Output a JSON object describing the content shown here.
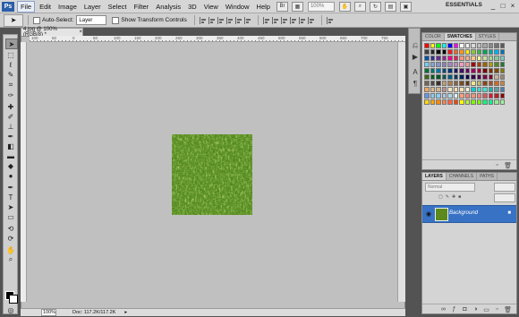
{
  "menubar": {
    "logo": "Ps",
    "items": [
      "File",
      "Edit",
      "Image",
      "Layer",
      "Select",
      "Filter",
      "Analysis",
      "3D",
      "View",
      "Window",
      "Help"
    ],
    "zoom": "100%",
    "workspace": "ESSENTIALS",
    "win_buttons": [
      "_",
      "□",
      "×"
    ]
  },
  "options": {
    "auto_select_label": "Auto-Select:",
    "auto_select_value": "Layer",
    "transform_label": "Show Transform Controls"
  },
  "document": {
    "tab_title": "4.jpg @ 100% (RGB/8) *",
    "ruler_numbers": [
      "100",
      "50",
      "0",
      "50",
      "100",
      "150",
      "200",
      "250",
      "300",
      "350",
      "400",
      "450",
      "500",
      "550",
      "600",
      "650",
      "700",
      "750"
    ],
    "status_zoom": "100%",
    "status_doc": "Doc: 117.2K/117.2K"
  },
  "swatches": {
    "tabs": [
      "COLOR",
      "SWATCHES",
      "STYLES"
    ],
    "colors": [
      "#ff0000",
      "#ffff00",
      "#00ff00",
      "#00ffff",
      "#0000ff",
      "#ff00ff",
      "#ffffff",
      "#f2f2f2",
      "#d9d9d9",
      "#bfbfbf",
      "#a6a6a6",
      "#8c8c8c",
      "#737373",
      "#595959",
      "#404040",
      "#262626",
      "#0d0d0d",
      "#000000",
      "#ed1c24",
      "#f26522",
      "#f7941d",
      "#fff200",
      "#8dc63f",
      "#39b54a",
      "#00a651",
      "#00a99d",
      "#00aeef",
      "#0072bc",
      "#0054a6",
      "#2e3192",
      "#662d91",
      "#92278f",
      "#ec008c",
      "#ed145b",
      "#f69679",
      "#f9ad81",
      "#fdc689",
      "#fff799",
      "#c4df9b",
      "#a3d39c",
      "#82ca9c",
      "#7accc8",
      "#6dcff6",
      "#7da7d9",
      "#8393ca",
      "#8781bd",
      "#a187be",
      "#bd8cbf",
      "#f49ac1",
      "#f5989d",
      "#9e0b0f",
      "#a0410d",
      "#a36209",
      "#aba000",
      "#598527",
      "#1a7b30",
      "#007236",
      "#00746b",
      "#0076a3",
      "#004b80",
      "#003471",
      "#1b1464",
      "#440e62",
      "#630460",
      "#9e005d",
      "#9e0039",
      "#790000",
      "#7b2e00",
      "#7d4900",
      "#827b00",
      "#406618",
      "#005e20",
      "#005826",
      "#005952",
      "#005b7f",
      "#003663",
      "#002157",
      "#0d004c",
      "#32004b",
      "#4b0049",
      "#7b0046",
      "#7a0026",
      "#c7b299",
      "#998675",
      "#736357",
      "#534741",
      "#37302a",
      "#c69c6d",
      "#a67c52",
      "#8c6239",
      "#754c24",
      "#603913",
      "#f0e68c",
      "#bdb76b",
      "#8b4513",
      "#a0522d",
      "#d2691e",
      "#cd853f",
      "#f4a460",
      "#deb887",
      "#d2b48c",
      "#bc8f8f",
      "#ffe4c4",
      "#ffdead",
      "#f5deb3",
      "#fff8dc",
      "#00ced1",
      "#48d1cc",
      "#40e0d0",
      "#20b2aa",
      "#5f9ea0",
      "#4682b4",
      "#6495ed",
      "#87ceeb",
      "#87cefa",
      "#b0c4de",
      "#add8e6",
      "#e0ffff",
      "#ffa07a",
      "#fa8072",
      "#e9967a",
      "#f08080",
      "#cd5c5c",
      "#dc143c",
      "#b22222",
      "#8b0000",
      "#ffd700",
      "#ffa500",
      "#ff8c00",
      "#ff7f50",
      "#ff6347",
      "#ff4500",
      "#ffff00",
      "#adff2f",
      "#7fff00",
      "#7cfc00",
      "#00ff7f",
      "#00fa9a",
      "#90ee90",
      "#98fb98"
    ]
  },
  "layers": {
    "tabs": [
      "LAYERS",
      "CHANNELS",
      "PATHS"
    ],
    "blend_mode": "Normal",
    "layer_name": "Background"
  }
}
